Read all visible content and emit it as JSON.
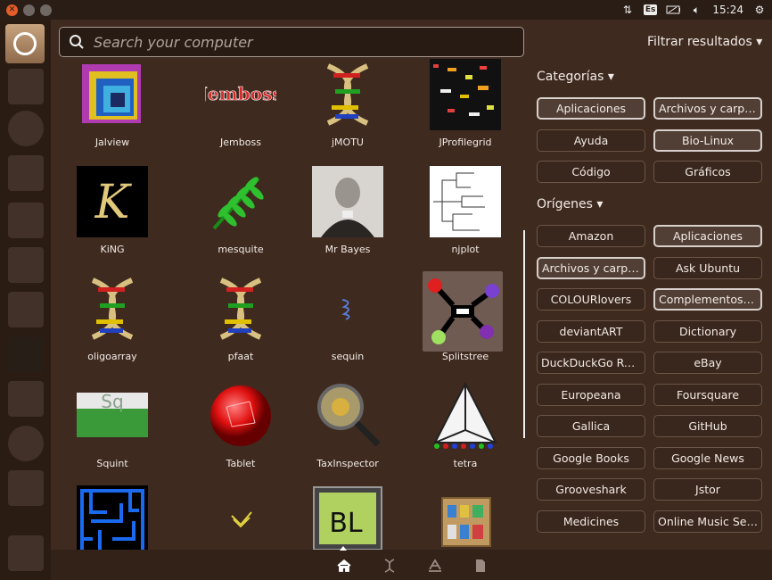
{
  "search": {
    "placeholder": "Search your computer"
  },
  "filter_toggle": "Filtrar resultados ▾",
  "tray": {
    "keyboard": "Es",
    "clock": "15:24"
  },
  "apps": [
    {
      "label": "Jalview",
      "icon": "jalview-icon"
    },
    {
      "label": "Jemboss",
      "icon": "jemboss-icon"
    },
    {
      "label": "jMOTU",
      "icon": "dna-icon"
    },
    {
      "label": "JProfilegrid",
      "icon": "jprofilegrid-icon"
    },
    {
      "label": "KiNG",
      "icon": "king-icon"
    },
    {
      "label": "mesquite",
      "icon": "mesquite-icon"
    },
    {
      "label": "Mr Bayes",
      "icon": "mrbayes-portrait-icon"
    },
    {
      "label": "njplot",
      "icon": "tree-icon"
    },
    {
      "label": "oligoarray",
      "icon": "dna-icon"
    },
    {
      "label": "pfaat",
      "icon": "dna-icon"
    },
    {
      "label": "sequin",
      "icon": "sequin-icon"
    },
    {
      "label": "Splitstree",
      "icon": "splitstree-icon"
    },
    {
      "label": "Squint",
      "icon": "squint-icon"
    },
    {
      "label": "Tablet",
      "icon": "tablet-icon"
    },
    {
      "label": "TaxInspector",
      "icon": "taxinspector-icon"
    },
    {
      "label": "tetra",
      "icon": "tetra-icon"
    },
    {
      "label": "",
      "icon": "maze-icon"
    },
    {
      "label": "",
      "icon": "chevron-icon"
    },
    {
      "label": "",
      "icon": "bl-monitor-icon"
    },
    {
      "label": "",
      "icon": "cabinet-icon"
    }
  ],
  "categories": {
    "title": "Categorías ▾",
    "items": [
      {
        "label": "Aplicaciones",
        "active": true
      },
      {
        "label": "Archivos y carpetas",
        "active": true
      },
      {
        "label": "Ayuda",
        "active": false
      },
      {
        "label": "Bio-Linux",
        "active": true
      },
      {
        "label": "Código",
        "active": false
      },
      {
        "label": "Gráficos",
        "active": false
      }
    ]
  },
  "origins": {
    "title": "Orígenes ▾",
    "items": [
      {
        "label": "Amazon",
        "active": false
      },
      {
        "label": "Aplicaciones",
        "active": true
      },
      {
        "label": "Archivos y carpetas",
        "active": true
      },
      {
        "label": "Ask Ubuntu",
        "active": false
      },
      {
        "label": "COLOURlovers",
        "active": false
      },
      {
        "label": "Complementos d...",
        "active": true
      },
      {
        "label": "deviantART",
        "active": false
      },
      {
        "label": "Dictionary",
        "active": false
      },
      {
        "label": "DuckDuckGo Rel...",
        "active": false
      },
      {
        "label": "eBay",
        "active": false
      },
      {
        "label": "Europeana",
        "active": false
      },
      {
        "label": "Foursquare",
        "active": false
      },
      {
        "label": "Gallica",
        "active": false
      },
      {
        "label": "GitHub",
        "active": false
      },
      {
        "label": "Google Books",
        "active": false
      },
      {
        "label": "Google News",
        "active": false
      },
      {
        "label": "Grooveshark",
        "active": false
      },
      {
        "label": "Jstor",
        "active": false
      },
      {
        "label": "Medicines",
        "active": false
      },
      {
        "label": "Online Music Sea...",
        "active": false
      }
    ]
  },
  "lenses": [
    "home-lens-icon",
    "dna-lens-icon",
    "apps-lens-icon",
    "files-lens-icon"
  ]
}
